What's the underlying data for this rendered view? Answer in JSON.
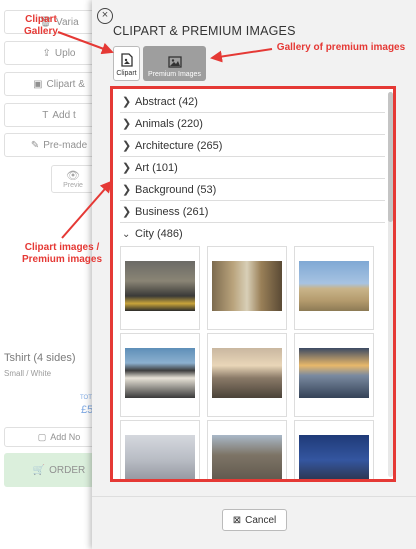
{
  "background": {
    "buttons": [
      "Varia",
      "Uplo",
      "Clipart &",
      "Add t",
      "Pre-made"
    ],
    "preview_label": "Previe",
    "product_name": "Tshirt (4 sides)",
    "product_sub": "Small / White",
    "total_label": "TOT",
    "price": "£5",
    "add_note": "Add No",
    "order": "ORDER"
  },
  "modal": {
    "close_icon": "×",
    "title": "CLIPART & PREMIUM IMAGES",
    "tabs": [
      {
        "label": "Clipart",
        "icon": "file-image-icon"
      },
      {
        "label": "Premium Images",
        "icon": "image-icon"
      }
    ],
    "categories": [
      {
        "label": "Abstract (42)",
        "expanded": false
      },
      {
        "label": "Animals (220)",
        "expanded": false
      },
      {
        "label": "Architecture (265)",
        "expanded": false
      },
      {
        "label": "Art (101)",
        "expanded": false
      },
      {
        "label": "Background (53)",
        "expanded": false
      },
      {
        "label": "Business (261)",
        "expanded": false
      },
      {
        "label": "City (486)",
        "expanded": true
      }
    ],
    "cancel_label": "Cancel"
  },
  "annotations": {
    "clipart_gallery": "Clipart\nGallery",
    "premium_gallery": "Gallery of premium images",
    "clipart_images": "Clipart images /\nPremium images"
  },
  "colors": {
    "annotation_red": "#e53935",
    "tab_active": "#9e9e9e",
    "order_green": "#c8e6c9"
  }
}
